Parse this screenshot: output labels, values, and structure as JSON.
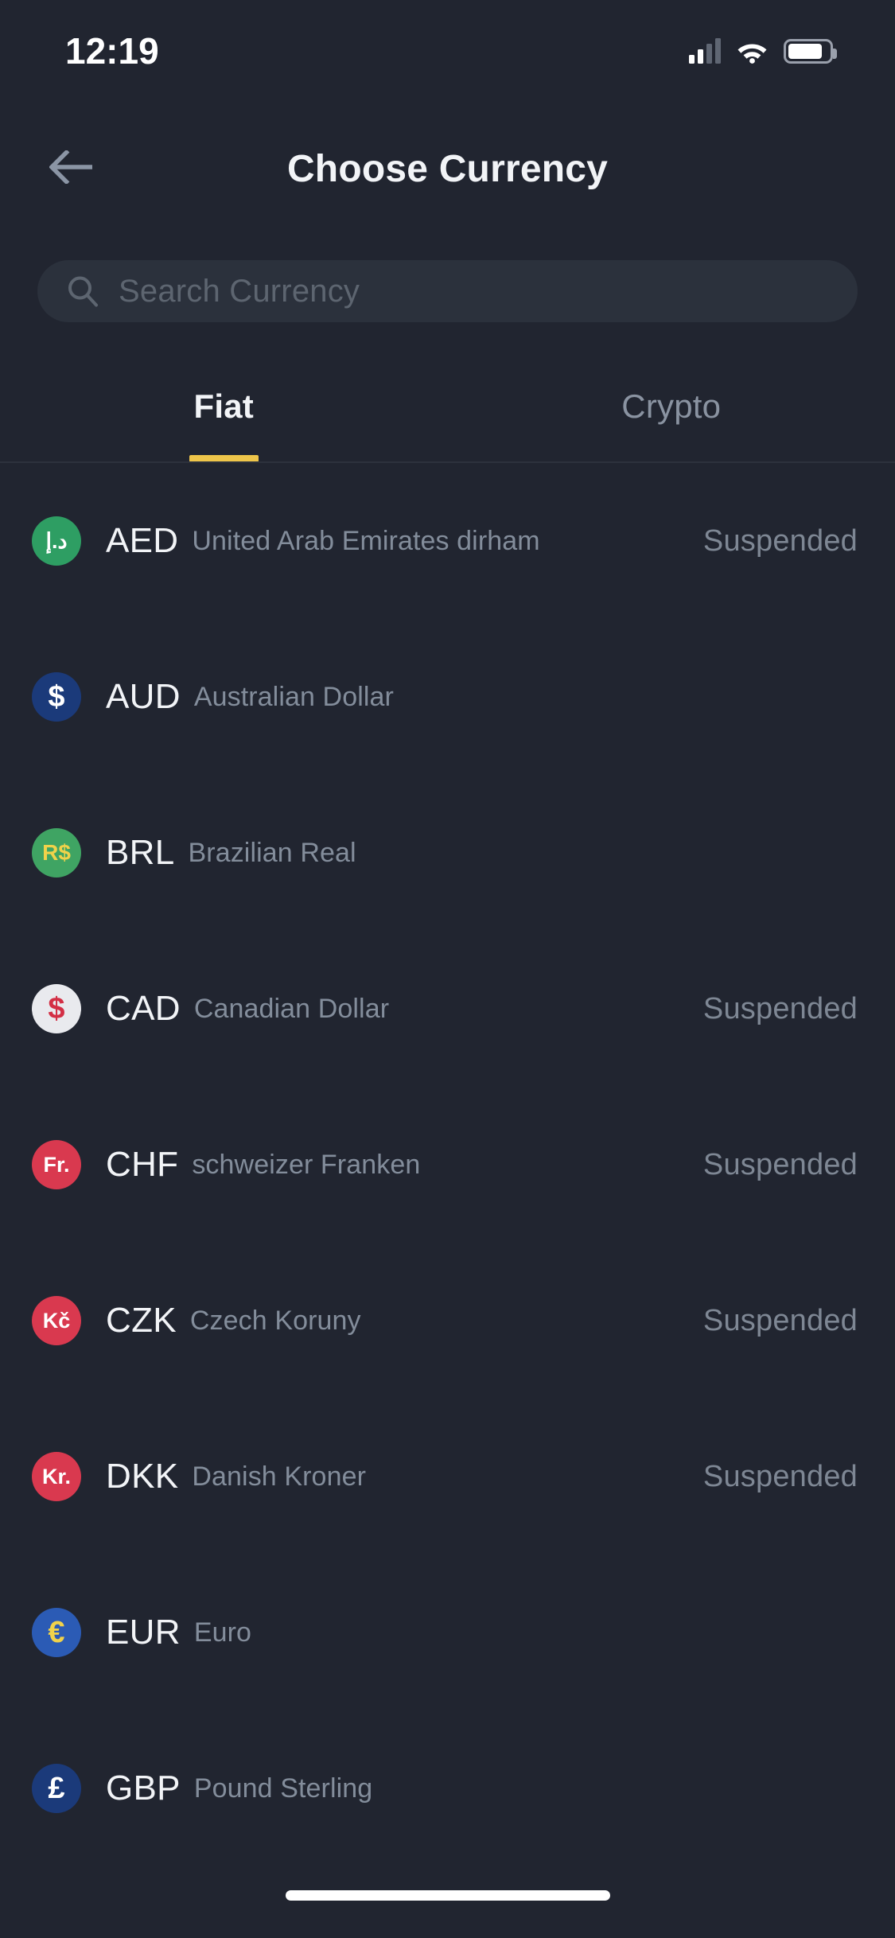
{
  "status_bar": {
    "time": "12:19",
    "signal_icon": "cellular-signal-icon",
    "wifi_icon": "wifi-icon",
    "battery_icon": "battery-icon"
  },
  "header": {
    "back_icon": "back-arrow-icon",
    "title": "Choose Currency"
  },
  "search": {
    "icon": "search-icon",
    "placeholder": "Search Currency",
    "value": ""
  },
  "tabs": [
    {
      "label": "Fiat",
      "active": true
    },
    {
      "label": "Crypto",
      "active": false
    }
  ],
  "colors": {
    "background": "#212530",
    "search_bg": "#2b313c",
    "accent": "#eec54a",
    "primary_text": "#f2f4f7",
    "muted_text": "#838d9b",
    "divider": "#2d323d"
  },
  "currencies": [
    {
      "code": "AED",
      "name": "United Arab Emirates dirham",
      "status": "Suspended",
      "symbol": "د.إ",
      "badge_bg": "#2e9e63",
      "badge_fg": "#ffffff",
      "symbol_size": "27px"
    },
    {
      "code": "AUD",
      "name": "Australian Dollar",
      "status": "",
      "symbol": "$",
      "badge_bg": "#1b3a7a",
      "badge_fg": "#ffffff",
      "symbol_size": "38px"
    },
    {
      "code": "BRL",
      "name": "Brazilian Real",
      "status": "",
      "symbol": "R$",
      "badge_bg": "#3fa463",
      "badge_fg": "#f0d24a",
      "symbol_size": "28px"
    },
    {
      "code": "CAD",
      "name": "Canadian Dollar",
      "status": "Suspended",
      "symbol": "$",
      "badge_bg": "#e9eaee",
      "badge_fg": "#d32f45",
      "symbol_size": "38px"
    },
    {
      "code": "CHF",
      "name": "schweizer Franken",
      "status": "Suspended",
      "symbol": "Fr.",
      "badge_bg": "#d9394f",
      "badge_fg": "#ffffff",
      "symbol_size": "27px"
    },
    {
      "code": "CZK",
      "name": "Czech Koruny",
      "status": "Suspended",
      "symbol": "Kč",
      "badge_bg": "#d9394f",
      "badge_fg": "#ffffff",
      "symbol_size": "27px"
    },
    {
      "code": "DKK",
      "name": "Danish Kroner",
      "status": "Suspended",
      "symbol": "Kr.",
      "badge_bg": "#d9394f",
      "badge_fg": "#ffffff",
      "symbol_size": "27px"
    },
    {
      "code": "EUR",
      "name": "Euro",
      "status": "",
      "symbol": "€",
      "badge_bg": "#2b5bb5",
      "badge_fg": "#f0d24a",
      "symbol_size": "38px"
    },
    {
      "code": "GBP",
      "name": "Pound Sterling",
      "status": "",
      "symbol": "£",
      "badge_bg": "#1b3a7a",
      "badge_fg": "#ffffff",
      "symbol_size": "38px"
    }
  ],
  "home_indicator": "home-indicator"
}
